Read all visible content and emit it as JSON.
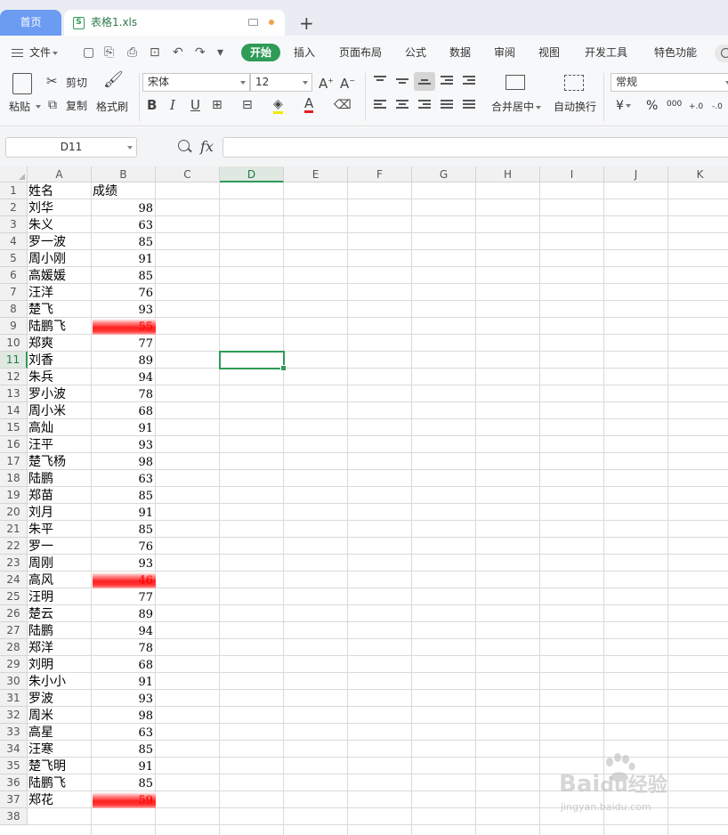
{
  "tabs": {
    "home": "首页",
    "file": "表格1.xls"
  },
  "menu": {
    "file": "文件",
    "items": [
      "开始",
      "插入",
      "页面布局",
      "公式",
      "数据",
      "审阅",
      "视图",
      "开发工具",
      "特色功能"
    ]
  },
  "ribbon": {
    "paste": "粘贴",
    "cut": "剪切",
    "copy": "复制",
    "format_painter": "格式刷",
    "font_name": "宋体",
    "font_size": "12",
    "merge_center": "合并居中",
    "wrap_text": "自动换行",
    "number_format": "常规",
    "currency_symbol": "¥",
    "percent_symbol": "%",
    "thousands": "000",
    "dec_increase": "+.0",
    "dec_decrease": "-.0"
  },
  "formula_bar": {
    "cell_ref": "D11",
    "fx": "fx",
    "content": ""
  },
  "columns": [
    "A",
    "B",
    "C",
    "D",
    "E",
    "F",
    "G",
    "H",
    "I",
    "J",
    "K"
  ],
  "active_column": "D",
  "active_row": 11,
  "row_count": 38,
  "header_row": {
    "name": "姓名",
    "score": "成绩"
  },
  "records": [
    {
      "name": "刘华",
      "score": "98"
    },
    {
      "name": "朱义",
      "score": "63"
    },
    {
      "name": "罗一波",
      "score": "85"
    },
    {
      "name": "周小刚",
      "score": "91"
    },
    {
      "name": "高媛媛",
      "score": "85"
    },
    {
      "name": "汪洋",
      "score": "76"
    },
    {
      "name": "楚飞",
      "score": "93"
    },
    {
      "name": "陆鹏飞",
      "score": "55",
      "low": true
    },
    {
      "name": "郑爽",
      "score": "77"
    },
    {
      "name": "刘香",
      "score": "89"
    },
    {
      "name": "朱兵",
      "score": "94"
    },
    {
      "name": "罗小波",
      "score": "78"
    },
    {
      "name": "周小米",
      "score": "68"
    },
    {
      "name": "高灿",
      "score": "91"
    },
    {
      "name": "汪平",
      "score": "93"
    },
    {
      "name": "楚飞杨",
      "score": "98"
    },
    {
      "name": "陆鹏",
      "score": "63"
    },
    {
      "name": "郑苗",
      "score": "85"
    },
    {
      "name": "刘月",
      "score": "91"
    },
    {
      "name": "朱平",
      "score": "85"
    },
    {
      "name": "罗一",
      "score": "76"
    },
    {
      "name": "周刚",
      "score": "93"
    },
    {
      "name": "高风",
      "score": "46",
      "low": true
    },
    {
      "name": "汪明",
      "score": "77"
    },
    {
      "name": "楚云",
      "score": "89"
    },
    {
      "name": "陆鹏",
      "score": "94"
    },
    {
      "name": "郑洋",
      "score": "78"
    },
    {
      "name": "刘明",
      "score": "68"
    },
    {
      "name": "朱小小",
      "score": "91"
    },
    {
      "name": "罗波",
      "score": "93"
    },
    {
      "name": "周米",
      "score": "98"
    },
    {
      "name": "高星",
      "score": "63"
    },
    {
      "name": "汪寒",
      "score": "85"
    },
    {
      "name": "楚飞明",
      "score": "91"
    },
    {
      "name": "陆鹏飞",
      "score": "85"
    },
    {
      "name": "郑花",
      "score": "59",
      "low": true
    }
  ],
  "colors": {
    "accent": "#2e9b57",
    "home_tab": "#6b9cf2",
    "low_score": "#ff2020"
  },
  "watermark": {
    "brand": "Bai",
    "brand2": "du",
    "sub_brand": "经验",
    "url": "jingyan.baidu.com"
  }
}
